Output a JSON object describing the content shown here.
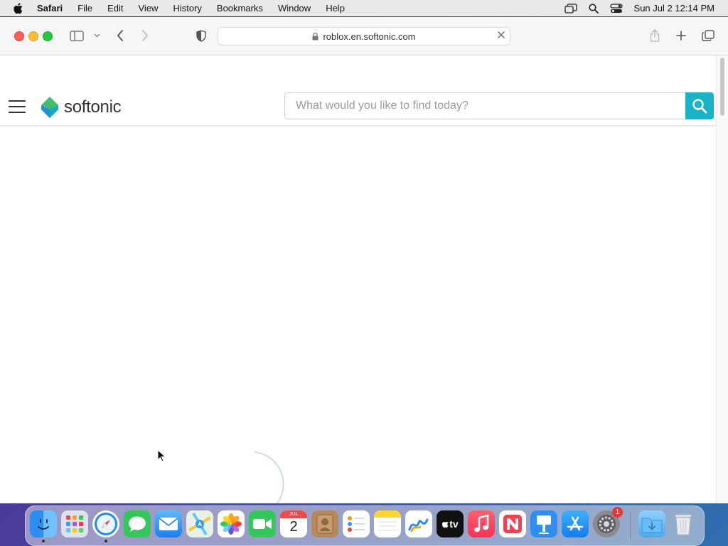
{
  "menubar": {
    "app_name": "Safari",
    "items": [
      "File",
      "Edit",
      "View",
      "History",
      "Bookmarks",
      "Window",
      "Help"
    ],
    "clock": "Sun Jul 2  12:14 PM"
  },
  "browser": {
    "url": "roblox.en.softonic.com"
  },
  "site": {
    "brand": "softonic",
    "search_placeholder": "What would you like to find today?",
    "colors": {
      "accent": "#16b4c6",
      "logo_green": "#3fbf6b",
      "logo_blue": "#1f8fd6"
    }
  },
  "dock": {
    "apps": [
      "Finder",
      "Launchpad",
      "Safari",
      "Messages",
      "Mail",
      "Maps",
      "Photos",
      "FaceTime",
      "Calendar",
      "Contacts",
      "Reminders",
      "Notes",
      "Freeform",
      "TV",
      "Music",
      "News",
      "Keynote",
      "App Store",
      "System Settings",
      "Downloads",
      "Trash"
    ],
    "calendar_month": "JUL",
    "calendar_day": "2",
    "tv_label": "tv",
    "settings_badge": "1"
  }
}
